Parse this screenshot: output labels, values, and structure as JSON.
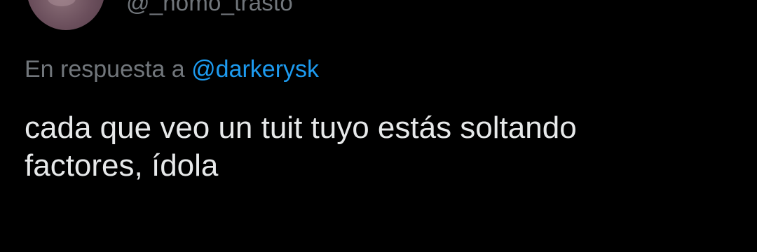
{
  "tweet": {
    "author": {
      "handle": "@_homo_trasto"
    },
    "reply_context": {
      "prefix": "En respuesta a",
      "mention": "@darkerysk"
    },
    "text": "cada que veo un tuit tuyo estás soltando\nfactores, ídola"
  },
  "colors": {
    "background": "#000000",
    "text_primary": "#e7e9ea",
    "text_secondary": "#71767b",
    "accent_link": "#1d9bf0"
  }
}
